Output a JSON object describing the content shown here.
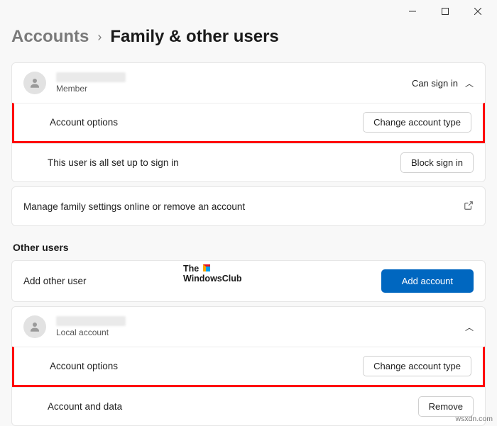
{
  "breadcrumb": {
    "parent": "Accounts",
    "current": "Family & other users"
  },
  "family_user": {
    "role": "Member",
    "status": "Can sign in",
    "options_label": "Account options",
    "change_type_btn": "Change account type",
    "setup_text": "This user is all set up to sign in",
    "block_btn": "Block sign in"
  },
  "manage_link": "Manage family settings online or remove an account",
  "other_users_title": "Other users",
  "add_other": {
    "label": "Add other user",
    "btn": "Add account"
  },
  "other_user": {
    "role": "Local account",
    "options_label": "Account options",
    "change_type_btn": "Change account type",
    "data_label": "Account and data",
    "remove_btn": "Remove"
  },
  "watermark": {
    "line1": "The",
    "line2": "WindowsClub"
  },
  "footer": "wsxdn.com"
}
